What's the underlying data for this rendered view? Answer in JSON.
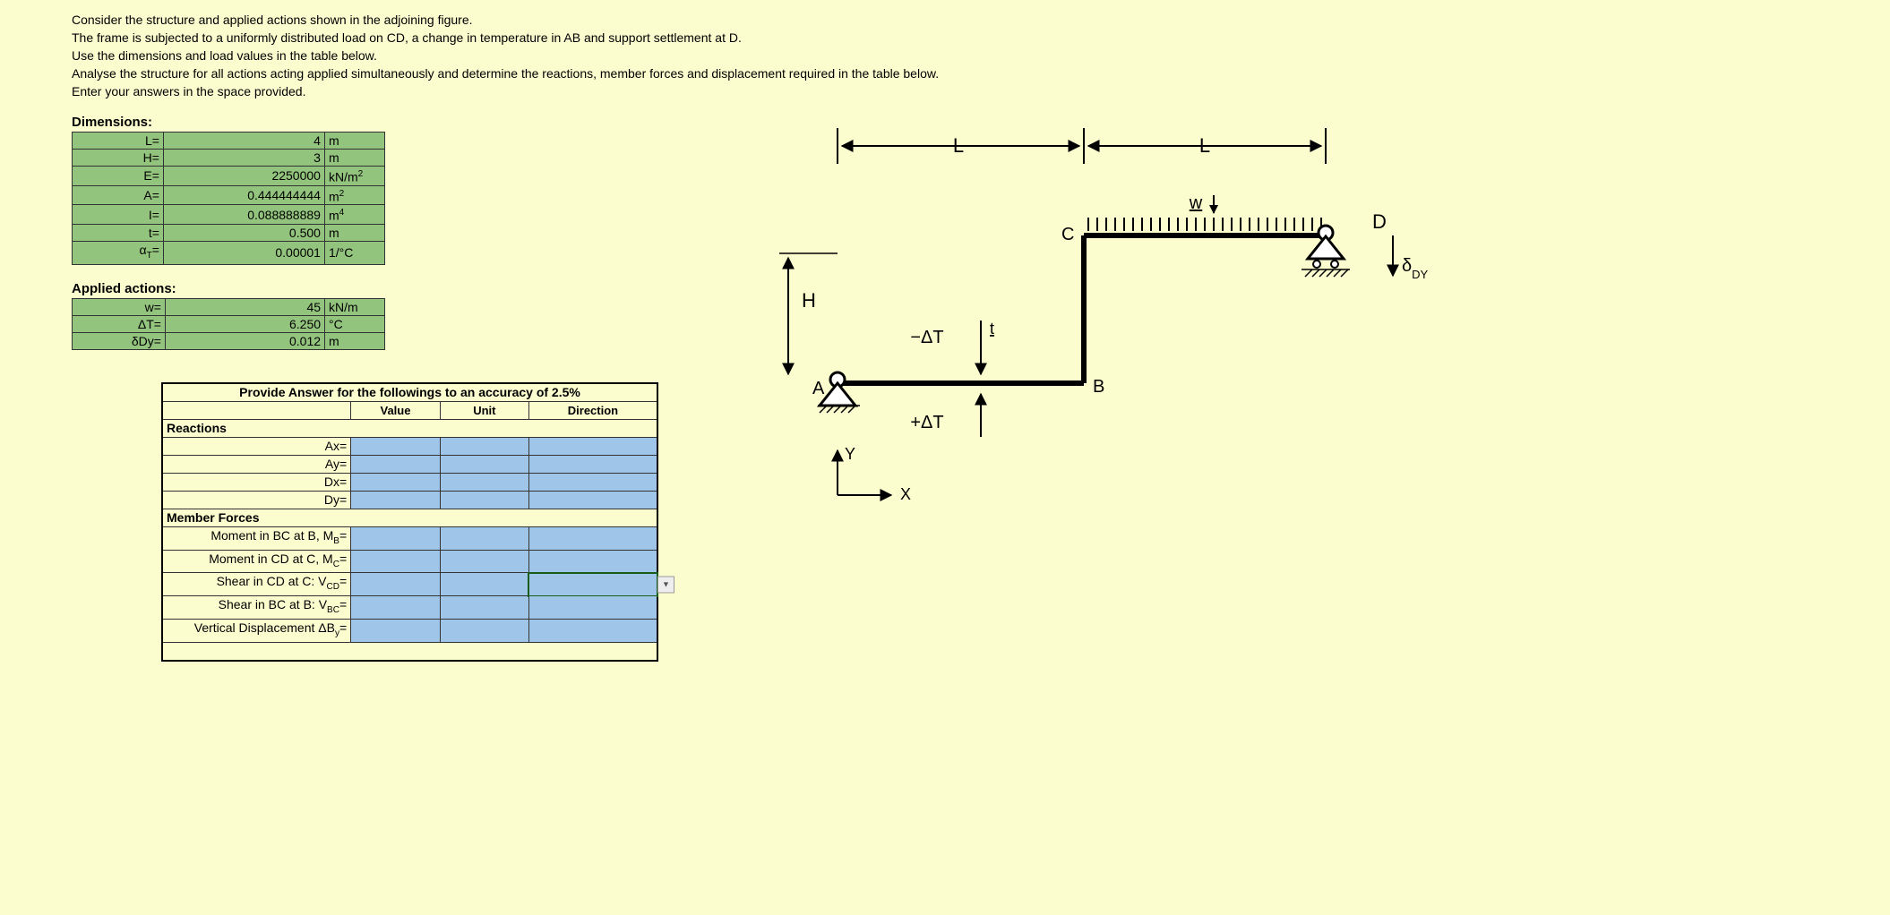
{
  "instructions": [
    "Consider the structure and applied actions shown in the adjoining figure.",
    "The frame is subjected to a  uniformly distributed load on CD, a change in temperature in AB and support settlement at D.",
    "Use the dimensions and load values in the table below.",
    "Analyse the structure for all actions acting applied simultaneously and determine the reactions, member forces and displacement required in the table below.",
    "Enter your answers in the space provided."
  ],
  "dimensions": {
    "title": "Dimensions:",
    "rows": [
      {
        "label": "L=",
        "value": "4",
        "unit": "m"
      },
      {
        "label": "H=",
        "value": "3",
        "unit": "m"
      },
      {
        "label": "E=",
        "value": "2250000",
        "unit_html": "kN/m<sup>2</sup>"
      },
      {
        "label": "A=",
        "value": "0.444444444",
        "unit_html": "m<sup>2</sup>"
      },
      {
        "label": "I=",
        "value": "0.088888889",
        "unit_html": "m<sup>4</sup>"
      },
      {
        "label": "t=",
        "value": "0.500",
        "unit": "m"
      },
      {
        "label_html": "α<sub>T</sub>=",
        "value": "0.00001",
        "unit_html": "1/°C"
      }
    ]
  },
  "applied": {
    "title": "Applied actions:",
    "rows": [
      {
        "label": "w=",
        "value": "45",
        "unit": "kN/m"
      },
      {
        "label_html": "ΔT=",
        "value": "6.250",
        "unit_html": "°C"
      },
      {
        "label_html": "δDy=",
        "value": "0.012",
        "unit": "m"
      }
    ]
  },
  "answer": {
    "title": "Provide Answer for the followings to an accuracy of 2.5%",
    "headers": {
      "c1": "",
      "c2": "Value",
      "c3": "Unit",
      "c4": "Direction"
    },
    "sections": [
      {
        "title": "Reactions",
        "rows": [
          {
            "label": "Ax="
          },
          {
            "label": "Ay="
          },
          {
            "label": "Dx="
          },
          {
            "label": "Dy="
          }
        ]
      },
      {
        "title": "Member Forces",
        "rows": [
          {
            "label_html": "Moment in BC at B, M<sub>B</sub>="
          },
          {
            "label_html": "Moment in CD at C, M<sub>C</sub>="
          },
          {
            "label_html": "Shear in CD at C: V<sub>CD</sub>=",
            "selected_direction": true
          },
          {
            "label_html": "Shear in BC at B: V<sub>BC</sub>="
          },
          {
            "label_html": "Vertical Displacement ΔB<sub>y</sub>="
          }
        ]
      }
    ]
  },
  "figure": {
    "labels": {
      "L": "L",
      "H": "H",
      "A": "A",
      "B": "B",
      "C": "C",
      "D": "D",
      "w": "w",
      "t": "t",
      "minusDT": "−ΔT",
      "plusDT": "+ΔT",
      "x": "X",
      "y": "Y",
      "dDY_html": "δ<sub>DY</sub>"
    }
  }
}
